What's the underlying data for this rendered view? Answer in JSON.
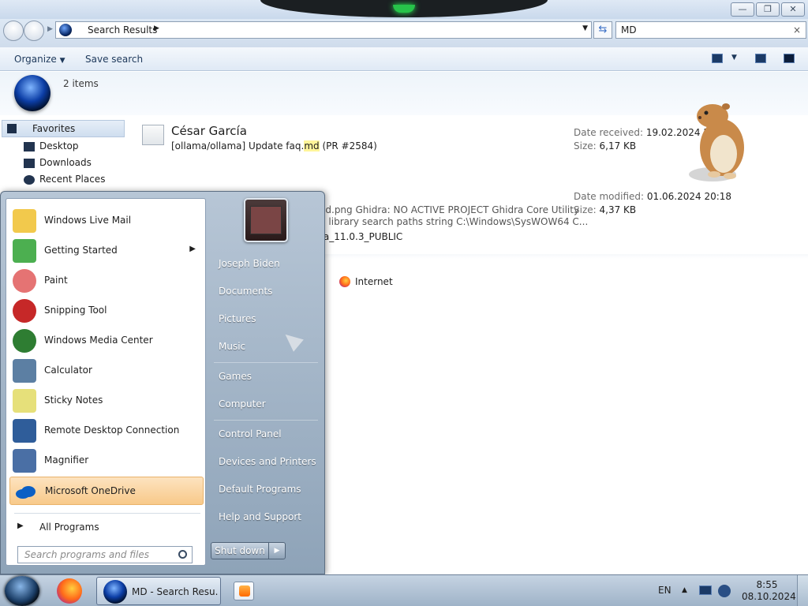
{
  "window": {
    "address_crumb": "Search Results",
    "search_value": "MD",
    "search_clear": "×",
    "controls": {
      "minimize": "—",
      "maximize": "❐",
      "close": "✕"
    }
  },
  "toolbar": {
    "organize_label": "Organize",
    "save_search_label": "Save search"
  },
  "info": {
    "item_count": "2 items"
  },
  "navpane": {
    "favorites_label": "Favorites",
    "items": [
      {
        "label": "Desktop"
      },
      {
        "label": "Downloads"
      },
      {
        "label": "Recent Places"
      }
    ]
  },
  "results": [
    {
      "title": "César García",
      "subject_before": "[ollama/ollama] Update faq.",
      "subject_highlight": "md",
      "subject_after": " (PR #2584)",
      "meta1_key": "Date received:",
      "meta1_val": "19.02.2024 5:17",
      "meta2_key": "Size:",
      "meta2_val": "6,17 KB"
    },
    {
      "line1": "ed.png Ghidra: NO ACTIVE PROJECT Ghidra Core Utility",
      "line2": "n library search paths string C:\\Windows\\SysWOW64 C...",
      "line3": "ra_11.0.3_PUBLIC",
      "meta1_key": "Date modified:",
      "meta1_val": "01.06.2024 20:18",
      "meta2_key": "Size:",
      "meta2_val": "4,37 KB"
    }
  ],
  "internet_label": "Internet",
  "startmenu": {
    "programs": [
      {
        "label": "Windows Live Mail",
        "color": "#f2c94c"
      },
      {
        "label": "Getting Started",
        "color": "#4caf50",
        "submenu": "▶"
      },
      {
        "label": "Paint",
        "color": "#e57373"
      },
      {
        "label": "Snipping Tool",
        "color": "#c62828"
      },
      {
        "label": "Windows Media Center",
        "color": "#2e7d32"
      },
      {
        "label": "Calculator",
        "color": "#5c7fa3"
      },
      {
        "label": "Sticky Notes",
        "color": "#e6e07a"
      },
      {
        "label": "Remote Desktop Connection",
        "color": "#2f5d9a"
      },
      {
        "label": "Magnifier",
        "color": "#4a6fa5"
      },
      {
        "label": "Microsoft OneDrive",
        "color": "#0b5fc4",
        "selected": true
      }
    ],
    "all_programs": "All Programs",
    "search_placeholder": "Search programs and files",
    "right_items": {
      "user": "Joseph Biden",
      "documents": "Documents",
      "pictures": "Pictures",
      "music": "Music",
      "games": "Games",
      "computer": "Computer",
      "control_panel": "Control Panel",
      "devices_printers": "Devices and Printers",
      "default_programs": "Default Programs",
      "help_support": "Help and Support"
    },
    "shutdown_label": "Shut down",
    "shutdown_arrow": "▶"
  },
  "taskbar": {
    "task_label": "MD - Search Resu...",
    "language": "EN",
    "time": "8:55",
    "date": "08.10.2024"
  }
}
